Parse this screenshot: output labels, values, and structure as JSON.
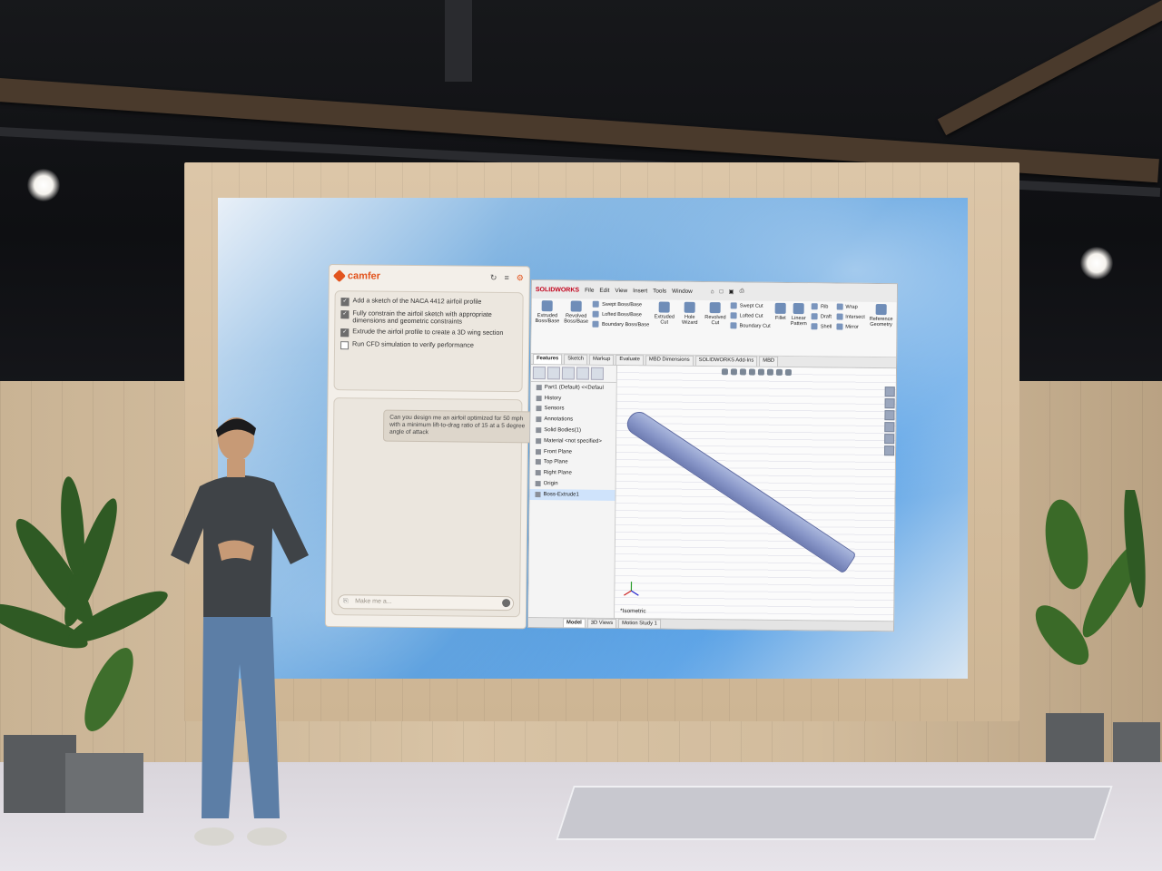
{
  "camfer": {
    "logo": "camfer",
    "tasks": [
      {
        "checked": true,
        "text": "Add a sketch of the NACA 4412 airfoil profile"
      },
      {
        "checked": true,
        "text": "Fully constrain the airfoil sketch with appropriate dimensions and geometric constraints"
      },
      {
        "checked": true,
        "text": "Extrude the airfoil profile to create a 3D wing section"
      },
      {
        "checked": false,
        "text": "Run CFD simulation to verify performance"
      }
    ],
    "message": "Can you design me an airfoil optimized for 50 mph with a minimum lift-to-drag ratio of 15 at a 5 degree angle of attack",
    "input_placeholder": "Make me a..."
  },
  "solidworks": {
    "brand": "SOLIDWORKS",
    "menu": [
      "File",
      "Edit",
      "View",
      "Insert",
      "Tools",
      "Window"
    ],
    "ribbon": {
      "extruded_boss": "Extruded Boss/Base",
      "revolved_boss": "Revolved Boss/Base",
      "swept_boss": "Swept Boss/Base",
      "lofted_boss": "Lofted Boss/Base",
      "boundary_boss": "Boundary Boss/Base",
      "extruded_cut": "Extruded Cut",
      "hole_wizard": "Hole Wizard",
      "revolved_cut": "Revolved Cut",
      "swept_cut": "Swept Cut",
      "lofted_cut": "Lofted Cut",
      "boundary_cut": "Boundary Cut",
      "fillet": "Fillet",
      "linear_pattern": "Linear Pattern",
      "rib": "Rib",
      "draft": "Draft",
      "shell": "Shell",
      "wrap": "Wrap",
      "intersect": "Intersect",
      "mirror": "Mirror",
      "reference_geometry": "Reference Geometry"
    },
    "tabs": [
      "Features",
      "Sketch",
      "Markup",
      "Evaluate",
      "MBD Dimensions",
      "SOLIDWORKS Add-Ins",
      "MBD"
    ],
    "tree": [
      "Part1 (Default) <<Defaul",
      "History",
      "Sensors",
      "Annotations",
      "Solid Bodies(1)",
      "Material <not specified>",
      "Front Plane",
      "Top Plane",
      "Right Plane",
      "Origin",
      "Boss-Extrude1"
    ],
    "view_label": "*Isometric",
    "bottom_tabs": [
      "Model",
      "3D Views",
      "Motion Study 1"
    ]
  }
}
